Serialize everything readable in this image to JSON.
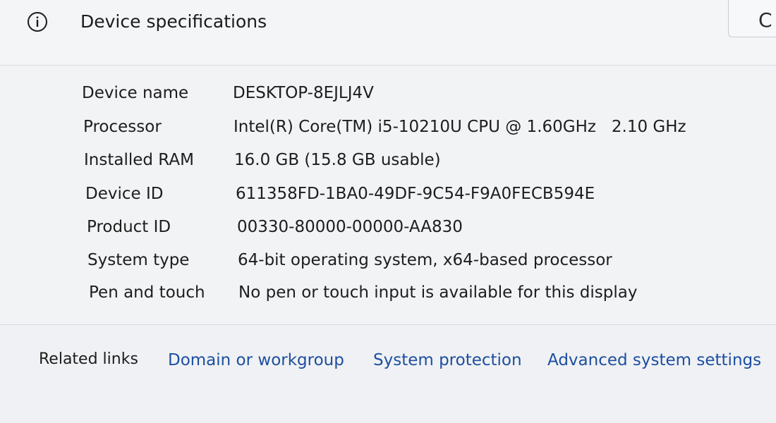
{
  "header": {
    "title": "Device specifications",
    "icon": "info-icon",
    "copy_label": "C"
  },
  "specs": [
    {
      "label": "Device name",
      "value": "DESKTOP-8EJLJ4V"
    },
    {
      "label": "Processor",
      "value": "Intel(R) Core(TM) i5-10210U CPU @ 1.60GHz   2.10 GHz"
    },
    {
      "label": "Installed RAM",
      "value": "16.0 GB (15.8 GB usable)"
    },
    {
      "label": "Device ID",
      "value": "611358FD-1BA0-49DF-9C54-F9A0FECB594E"
    },
    {
      "label": "Product ID",
      "value": "00330-80000-00000-AA830"
    },
    {
      "label": "System type",
      "value": "64-bit operating system, x64-based processor"
    },
    {
      "label": "Pen and touch",
      "value": "No pen or touch input is available for this display"
    }
  ],
  "related": {
    "label": "Related links",
    "links": [
      "Domain or workgroup",
      "System protection",
      "Advanced system settings"
    ]
  },
  "colors": {
    "link": "#1c4fa0",
    "background": "#f2f3f5"
  }
}
